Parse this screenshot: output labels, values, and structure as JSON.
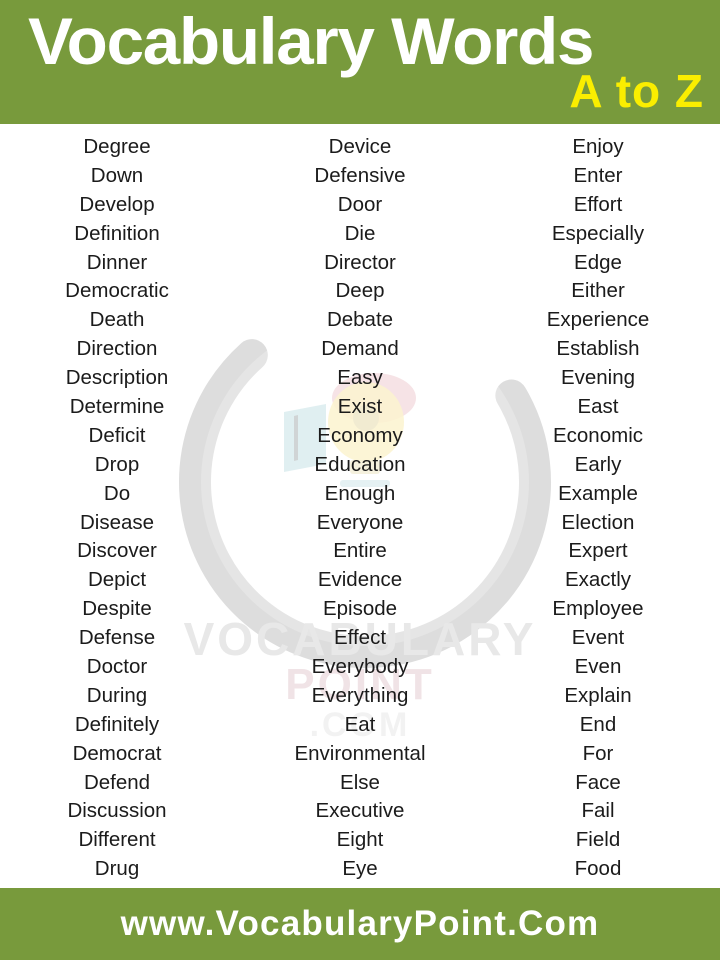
{
  "header": {
    "title": "Vocabulary Words",
    "subtitle": "A to Z",
    "bar_color": "#789A3C",
    "title_color": "#FFFFFF",
    "subtitle_color": "#FAEE00"
  },
  "watermark": {
    "line1": "VOCABULARY",
    "line2": "POINT",
    "line3": ".COM",
    "ring_color": "#DCDCDC"
  },
  "columns": [
    {
      "name": "column-1",
      "words": [
        "Degree",
        "Down",
        "Develop",
        "Definition",
        "Dinner",
        "Democratic",
        "Death",
        "Direction",
        "Description",
        "Determine",
        "Deficit",
        "Drop",
        "Do",
        "Disease",
        "Discover",
        "Depict",
        "Despite",
        "Defense",
        "Doctor",
        "During",
        "Definitely",
        "Democrat",
        "Defend",
        "Discussion",
        "Different",
        "Drug"
      ]
    },
    {
      "name": "column-2",
      "words": [
        "Device",
        "Defensive",
        "Door",
        "Die",
        "Director",
        "Deep",
        "Debate",
        "Demand",
        "Easy",
        "Exist",
        "Economy",
        "Education",
        "Enough",
        "Everyone",
        "Entire",
        "Evidence",
        "Episode",
        "Effect",
        "Everybody",
        "Everything",
        "Eat",
        "Environmental",
        "Else",
        "Executive",
        "Eight",
        "Eye"
      ]
    },
    {
      "name": "column-3",
      "words": [
        "Enjoy",
        "Enter",
        "Effort",
        "Especially",
        "Edge",
        "Either",
        "Experience",
        "Establish",
        "Evening",
        "East",
        "Economic",
        "Early",
        "Example",
        "Election",
        "Expert",
        "Exactly",
        "Employee",
        "Event",
        "Even",
        "Explain",
        "End",
        "For",
        "Face",
        "Fail",
        "Field",
        "Food"
      ]
    }
  ],
  "footer": {
    "text": "www.VocabularyPoint.Com",
    "bar_color": "#789A3C",
    "text_color": "#FFFFFF"
  }
}
